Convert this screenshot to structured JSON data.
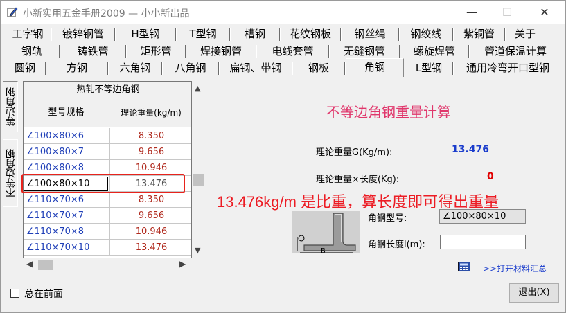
{
  "window": {
    "title": "小新实用五金手册2009 — 小小新出品",
    "min_glyph": "—",
    "max_glyph": "☐",
    "close_glyph": "✕"
  },
  "tabs": {
    "row1": [
      "工字钢",
      "镀锌钢管",
      "H型钢",
      "T型钢",
      "槽钢",
      "花纹钢板",
      "钢丝绳",
      "钢绞线",
      "紫铜管",
      "关于"
    ],
    "row2": [
      "钢轨",
      "铸铁管",
      "矩形管",
      "焊接钢管",
      "电线套管",
      "无缝钢管",
      "螺旋焊管",
      "管道保温计算"
    ],
    "row3": [
      "圆钢",
      "方钢",
      "六角钢",
      "八角钢",
      "扁钢、带钢",
      "钢板",
      "角钢",
      "L型钢",
      "通用冷弯开口型钢"
    ],
    "active": "角钢"
  },
  "side_tabs": [
    "等边角钢",
    "不等边角钢"
  ],
  "table": {
    "caption": "热轧不等边角钢",
    "columns": [
      "型号规格",
      "理论重量(kg/m)"
    ],
    "rows": [
      {
        "spec": "∠100×80×6",
        "weight": "8.350"
      },
      {
        "spec": "∠100×80×7",
        "weight": "9.656"
      },
      {
        "spec": "∠100×80×8",
        "weight": "10.946"
      },
      {
        "spec": "∠100×80×10",
        "weight": "13.476"
      },
      {
        "spec": "∠110×70×6",
        "weight": "8.350"
      },
      {
        "spec": "∠110×70×7",
        "weight": "9.656"
      },
      {
        "spec": "∠110×70×8",
        "weight": "10.946"
      },
      {
        "spec": "∠110×70×10",
        "weight": "13.476"
      }
    ],
    "selected_index": 3
  },
  "calc": {
    "title": "不等边角钢重量计算",
    "weight_label": "理论重量G(Kg/m):",
    "weight_value": "13.476",
    "total_label": "理论重量×长度(Kg):",
    "total_value": "0",
    "model_label": "角钢型号:",
    "model_value": "∠100×80×10",
    "length_label": "角钢长度l(m):",
    "length_value": "",
    "summary_link": ">>打开材料汇总",
    "diagram_label_b": "B"
  },
  "annotation": "13.476kg/m  是比重，算长度即可得出重量",
  "footer": {
    "always_on_top": "总在前面",
    "exit": "退出(X)"
  },
  "colors": {
    "title_pink": "#e0366b",
    "value_blue": "#1a3ccc",
    "value_red": "#e00000",
    "annotation_red": "#ec1c24"
  }
}
